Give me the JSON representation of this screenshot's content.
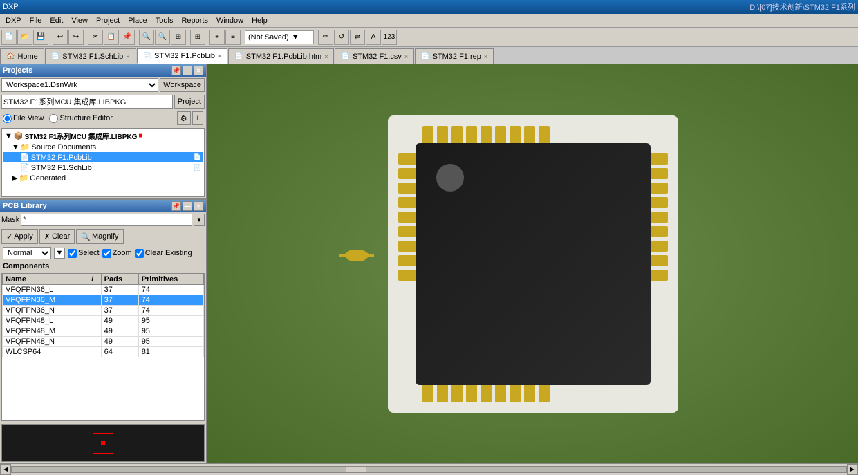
{
  "titlebar": {
    "app_name": "DXP",
    "title": "D:\\[07]技术创新\\STM32 F1系列",
    "menus": [
      "DXP",
      "File",
      "Edit",
      "View",
      "Project",
      "Place",
      "Tools",
      "Reports",
      "Window",
      "Help"
    ]
  },
  "toolbar": {
    "not_saved_label": "(Not Saved)",
    "dropdown_arrow": "▼"
  },
  "tabs": [
    {
      "label": "Home",
      "icon": "🏠",
      "active": false
    },
    {
      "label": "STM32 F1.SchLib",
      "icon": "📄",
      "active": false
    },
    {
      "label": "STM32 F1.PcbLib",
      "icon": "📄",
      "active": true
    },
    {
      "label": "STM32 F1.PcbLib.htm",
      "icon": "📄",
      "active": false
    },
    {
      "label": "STM32 F1.csv",
      "icon": "📄",
      "active": false
    },
    {
      "label": "STM32 F1.rep",
      "icon": "📄",
      "active": false
    }
  ],
  "projects_panel": {
    "title": "Projects",
    "workspace_value": "Workspace1.DsnWrk",
    "workspace_btn": "Workspace",
    "project_value": "STM32 F1系列MCU 集成库.LIBPKG",
    "project_btn": "Project",
    "radio_file_view": "File View",
    "radio_structure_editor": "Structure Editor",
    "tree": {
      "root": "STM32 F1系列MCU 集成库.LIBPKG",
      "source_documents": "Source Documents",
      "items": [
        {
          "name": "STM32 F1.PcbLib",
          "selected": true
        },
        {
          "name": "STM32 F1.SchLib",
          "selected": false
        }
      ],
      "generated": "Generated"
    }
  },
  "pcblib_panel": {
    "title": "PCB Library",
    "mask_label": "Mask",
    "mask_value": "*",
    "btn_apply": "Apply",
    "btn_clear": "Clear",
    "btn_magnify": "Magnify",
    "dropdown_normal": "Normal",
    "checkbox_select": "Select",
    "checkbox_zoom": "Zoom",
    "checkbox_clear_existing": "Clear Existing",
    "components_header": "Components",
    "columns": [
      "Name",
      "/",
      "Pads",
      "Primitives"
    ],
    "rows": [
      {
        "name": "VFQFPN36_L",
        "sort": "",
        "pads": "37",
        "primitives": "74",
        "selected": false
      },
      {
        "name": "VFQFPN36_M",
        "sort": "",
        "pads": "37",
        "primitives": "74",
        "selected": true
      },
      {
        "name": "VFQFPN36_N",
        "sort": "",
        "pads": "37",
        "primitives": "74",
        "selected": false
      },
      {
        "name": "VFQFPN48_L",
        "sort": "",
        "pads": "49",
        "primitives": "95",
        "selected": false
      },
      {
        "name": "VFQFPN48_M",
        "sort": "",
        "pads": "49",
        "primitives": "95",
        "selected": false
      },
      {
        "name": "VFQFPN48_N",
        "sort": "",
        "pads": "49",
        "primitives": "95",
        "selected": false
      },
      {
        "name": "WLCSP64",
        "sort": "",
        "pads": "64",
        "primitives": "81",
        "selected": false
      }
    ]
  },
  "canvas": {
    "background": "#5a7a3a"
  },
  "colors": {
    "accent_blue": "#3366aa",
    "selected_row": "#3399ff",
    "pad_gold": "#c8a820",
    "ic_black": "#1a1a1a",
    "pcb_white": "#e8e8e0"
  }
}
